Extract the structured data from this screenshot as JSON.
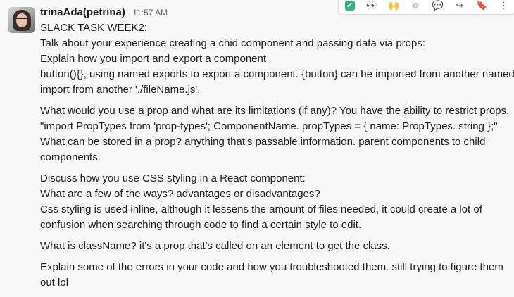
{
  "message": {
    "author": "trinaAda(petrina)",
    "time": "11:57 AM",
    "paragraphs": [
      [
        "SLACK TASK WEEK2:",
        "Talk about your experience creating a chid component and passing data via props:",
        "Explain how you import and export a component",
        "button(){}, using named exports to export a component. {button} can be imported from another named",
        "import from another './fileName.js'."
      ],
      [
        "What would you use a prop and what are its limitations (if any)? You have the ability to restrict props,",
        "\"import PropTypes from 'prop-types'; ComponentName. propTypes = { name: PropTypes. string };\"",
        "What can be stored in a prop? anything that's passable information. parent components to child",
        "components."
      ],
      [
        "Discuss how you use CSS styling in a React component:",
        "What are a few of the ways? advantages or disadvantages?",
        "Css styling is used inline, although it lessens the amount of files needed, it could create a lot of",
        "confusion when searching through code to find a certain style to edit."
      ],
      [
        "What is className? it's a prop that's called on an element to get the class."
      ],
      [
        "Explain some of the errors in your code and how you troubleshooted them.  still trying to figure them",
        "out lol"
      ]
    ]
  },
  "toolbar": {
    "icons": [
      "check-emoji",
      "eyes-emoji",
      "raised-hands-emoji",
      "add-reaction-icon",
      "reply-thread-icon",
      "share-icon",
      "bookmark-icon",
      "more-icon"
    ]
  },
  "colors": {
    "text": "#1d1c1d",
    "muted": "#616061",
    "check": "#2eb67d"
  }
}
